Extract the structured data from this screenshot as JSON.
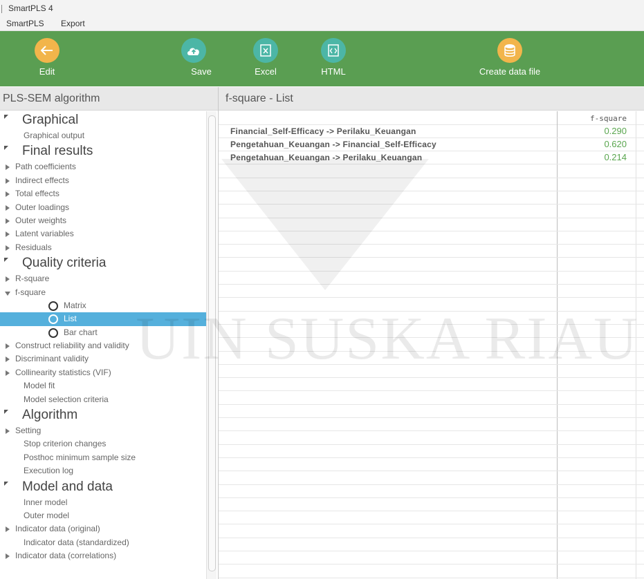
{
  "window": {
    "title": "SmartPLS 4"
  },
  "menu": {
    "items": [
      "SmartPLS",
      "Export"
    ]
  },
  "toolbar": {
    "edit_label": "Edit",
    "save_label": "Save",
    "excel_label": "Excel",
    "html_label": "HTML",
    "create_label": "Create data file"
  },
  "left_panel": {
    "title": "PLS-SEM algorithm"
  },
  "tree": [
    {
      "kind": "cat",
      "label": "Graphical"
    },
    {
      "kind": "item",
      "label": "Graphical output"
    },
    {
      "kind": "cat",
      "label": "Final results"
    },
    {
      "kind": "sub",
      "label": "Path coefficients"
    },
    {
      "kind": "sub",
      "label": "Indirect effects"
    },
    {
      "kind": "sub",
      "label": "Total effects"
    },
    {
      "kind": "sub",
      "label": "Outer loadings"
    },
    {
      "kind": "sub",
      "label": "Outer weights"
    },
    {
      "kind": "sub",
      "label": "Latent variables"
    },
    {
      "kind": "sub",
      "label": "Residuals"
    },
    {
      "kind": "cat",
      "label": "Quality criteria"
    },
    {
      "kind": "sub",
      "label": "R-square"
    },
    {
      "kind": "sub-open",
      "label": "f-square"
    },
    {
      "kind": "radio",
      "label": "Matrix"
    },
    {
      "kind": "radio-selected",
      "label": "List"
    },
    {
      "kind": "radio",
      "label": "Bar chart"
    },
    {
      "kind": "sub",
      "label": "Construct reliability and validity"
    },
    {
      "kind": "sub",
      "label": "Discriminant validity"
    },
    {
      "kind": "sub",
      "label": "Collinearity statistics (VIF)"
    },
    {
      "kind": "item",
      "label": "Model fit"
    },
    {
      "kind": "item",
      "label": "Model selection criteria"
    },
    {
      "kind": "cat",
      "label": "Algorithm"
    },
    {
      "kind": "sub",
      "label": "Setting"
    },
    {
      "kind": "item",
      "label": "Stop criterion changes"
    },
    {
      "kind": "item",
      "label": "Posthoc minimum sample size"
    },
    {
      "kind": "item",
      "label": "Execution log"
    },
    {
      "kind": "cat",
      "label": "Model and data"
    },
    {
      "kind": "item",
      "label": "Inner model"
    },
    {
      "kind": "item",
      "label": "Outer model"
    },
    {
      "kind": "sub",
      "label": "Indicator data (original)"
    },
    {
      "kind": "item",
      "label": "Indicator data (standardized)"
    },
    {
      "kind": "sub",
      "label": "Indicator data (correlations)"
    }
  ],
  "right_panel": {
    "title": "f-square - List"
  },
  "table": {
    "column_header": "f-square",
    "rows": [
      {
        "label": "Financial_Self-Efficacy -> Perilaku_Keuangan",
        "value": "0.290"
      },
      {
        "label": "Pengetahuan_Keuangan -> Financial_Self-Efficacy",
        "value": "0.620"
      },
      {
        "label": "Pengetahuan_Keuangan -> Perilaku_Keuangan",
        "value": "0.214"
      }
    ]
  },
  "watermark": {
    "text": "UIN SUSKA RIAU"
  },
  "colors": {
    "toolbar": "#5a9e52",
    "selected": "#55b0dc",
    "value": "#5aa64f",
    "orange": "#f2b54b",
    "teal": "#4cb6a6"
  }
}
